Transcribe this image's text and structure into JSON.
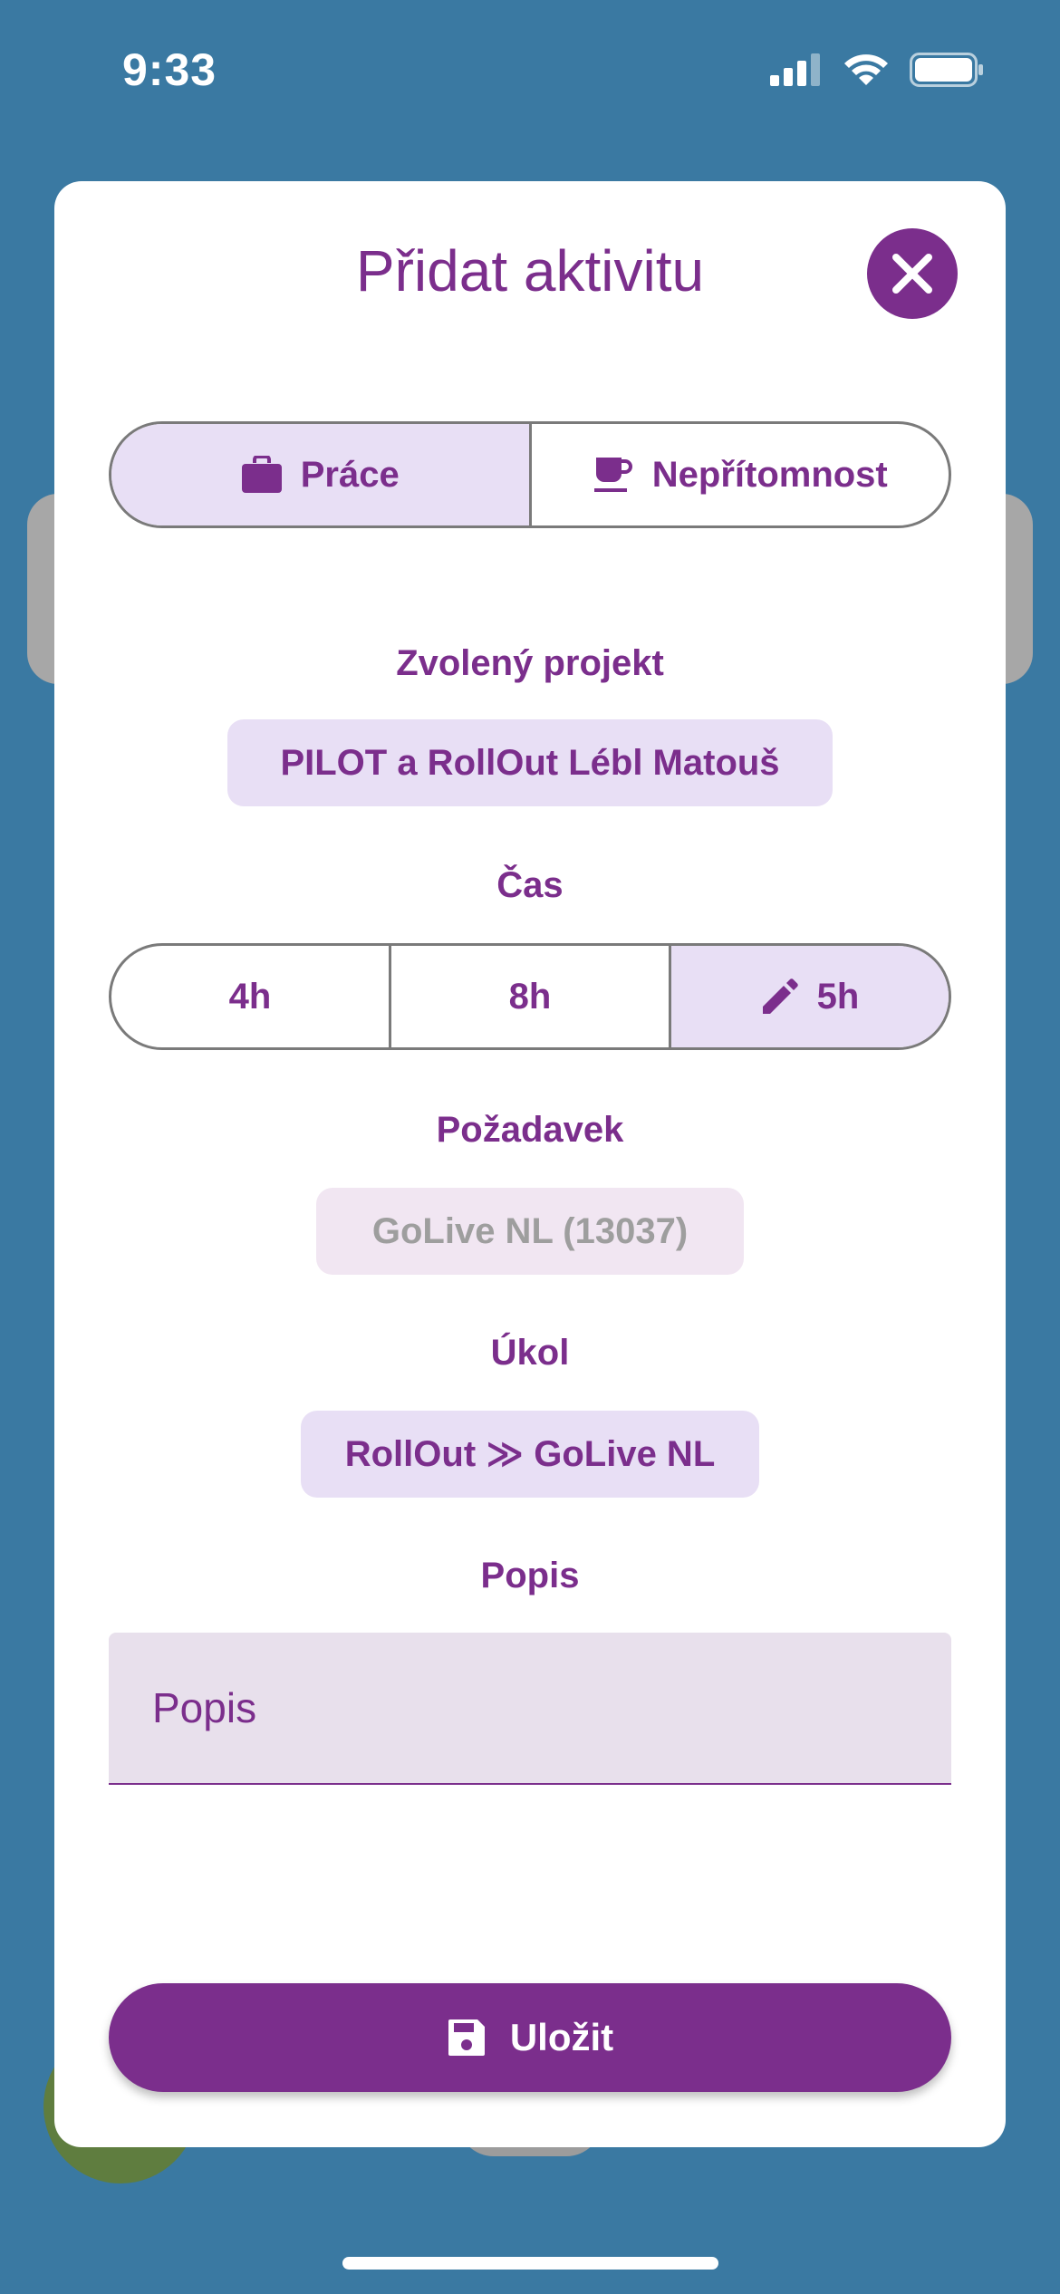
{
  "status_bar": {
    "time": "9:33"
  },
  "modal": {
    "title": "Přidat aktivitu",
    "close_icon": "close-icon"
  },
  "activity_type": {
    "options": [
      {
        "label": "Práce",
        "icon": "briefcase-icon",
        "selected": true
      },
      {
        "label": "Nepřítomnost",
        "icon": "coffee-cup-icon",
        "selected": false
      }
    ]
  },
  "project": {
    "label": "Zvolený projekt",
    "value": "PILOT a RollOut Lébl Matouš"
  },
  "time": {
    "label": "Čas",
    "options": [
      {
        "label": "4h",
        "selected": false
      },
      {
        "label": "8h",
        "selected": false
      },
      {
        "label": "5h",
        "icon": "pencil-icon",
        "selected": true
      }
    ]
  },
  "request": {
    "label": "Požadavek",
    "value": "GoLive NL (13037)"
  },
  "task": {
    "label": "Úkol",
    "value": "RollOut ≫ GoLive NL"
  },
  "description": {
    "label": "Popis",
    "placeholder": "Popis"
  },
  "save_button": {
    "label": "Uložit",
    "icon": "save-icon"
  },
  "colors": {
    "primary": "#7b2e8c",
    "selected_bg": "#e8dff5",
    "background": "#3a79a2"
  }
}
